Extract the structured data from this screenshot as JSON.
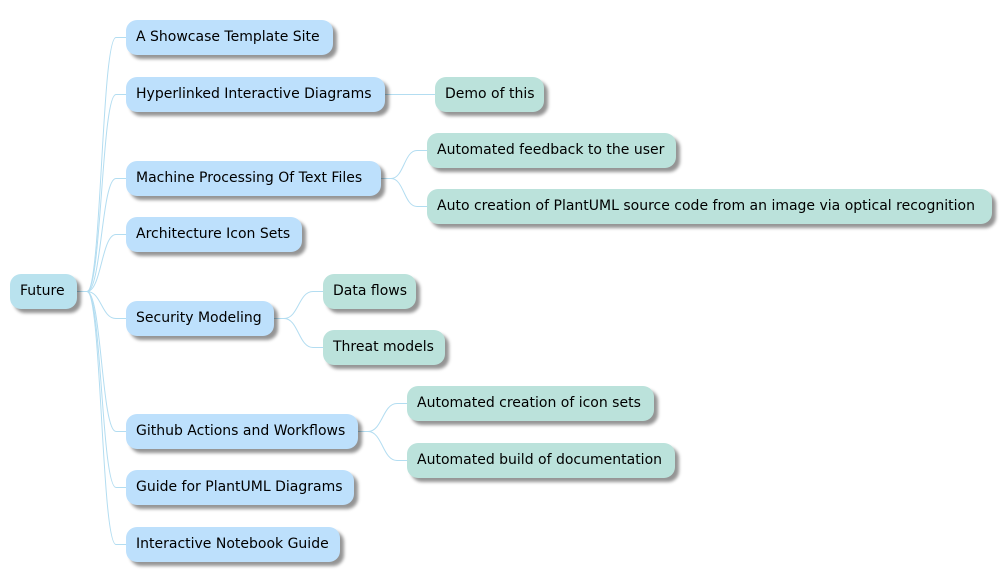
{
  "diagram": {
    "type": "mindmap",
    "colors": {
      "root_fill": "#B9E2EE",
      "level1_fill": "#BDE0FC",
      "level2_fill": "#BBE2DB",
      "connector": "#B3DDF1",
      "text": "#000000"
    },
    "root": {
      "label": "Future",
      "children": [
        {
          "label": "A Showcase Template Site",
          "children": []
        },
        {
          "label": "Hyperlinked Interactive Diagrams",
          "children": [
            {
              "label": "Demo of this"
            }
          ]
        },
        {
          "label": "Machine Processing Of Text Files",
          "children": [
            {
              "label": "Automated feedback to the user"
            },
            {
              "label": "Auto creation of PlantUML source code from an image via optical recognition"
            }
          ]
        },
        {
          "label": "Architecture Icon Sets",
          "children": []
        },
        {
          "label": "Security Modeling",
          "children": [
            {
              "label": "Data flows"
            },
            {
              "label": "Threat models"
            }
          ]
        },
        {
          "label": "Github Actions and Workflows",
          "children": [
            {
              "label": "Automated creation of icon sets"
            },
            {
              "label": "Automated build of documentation"
            }
          ]
        },
        {
          "label": "Guide for PlantUML Diagrams",
          "children": []
        },
        {
          "label": "Interactive Notebook Guide",
          "children": []
        }
      ]
    }
  }
}
